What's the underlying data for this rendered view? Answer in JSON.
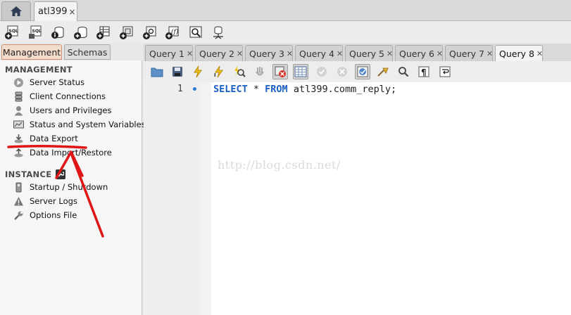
{
  "connection": {
    "home_icon": "home-icon",
    "tab_label": "atl399",
    "close_glyph": "×"
  },
  "main_toolbar": {
    "icons": [
      "new-sql-tab-icon",
      "open-sql-script-icon",
      "info-icon",
      "create-schema-icon",
      "create-table-icon",
      "create-view-icon",
      "create-procedure-icon",
      "create-function-icon",
      "search-table-data-icon",
      "reconnect-icon"
    ]
  },
  "left_tabs": {
    "management": "Management",
    "schemas": "Schemas"
  },
  "sections": {
    "management_title": "MANAGEMENT",
    "management_items": [
      {
        "label": "Server Status",
        "icon": "play-icon"
      },
      {
        "label": "Client Connections",
        "icon": "connections-icon"
      },
      {
        "label": "Users and Privileges",
        "icon": "user-icon"
      },
      {
        "label": "Status and System Variables",
        "icon": "monitor-icon"
      },
      {
        "label": "Data Export",
        "icon": "export-icon"
      },
      {
        "label": "Data Import/Restore",
        "icon": "import-icon"
      }
    ],
    "instance_title": "INSTANCE",
    "instance_icon": "wrench-icon",
    "instance_items": [
      {
        "label": "Startup / Shutdown",
        "icon": "startup-icon"
      },
      {
        "label": "Server Logs",
        "icon": "warning-icon"
      },
      {
        "label": "Options File",
        "icon": "wrench-icon"
      }
    ]
  },
  "query_tabs": [
    "Query 1",
    "Query 2",
    "Query 3",
    "Query 4",
    "Query 5",
    "Query 6",
    "Query 7",
    "Query 8"
  ],
  "active_query_tab": "Query 8",
  "sql_toolbar": {
    "icons": [
      "open-file-icon",
      "save-icon",
      "execute-icon",
      "execute-current-icon",
      "explain-icon",
      "stop-icon",
      "toggle-error-icon",
      "limit-rows-icon",
      "commit-icon",
      "rollback-icon",
      "autocommit-icon",
      "beautify-icon",
      "find-icon",
      "invisible-chars-icon",
      "wrap-icon"
    ]
  },
  "editor": {
    "line_number": "1",
    "keyword_select": "SELECT",
    "star": " * ",
    "keyword_from": "FROM",
    "table": " atl399.comm_reply;",
    "watermark": "http://blog.csdn.net/"
  },
  "colors": {
    "accent_blue": "#1a5ec4",
    "annotation_red": "#e01515",
    "management_tab": "#f4dccc"
  }
}
